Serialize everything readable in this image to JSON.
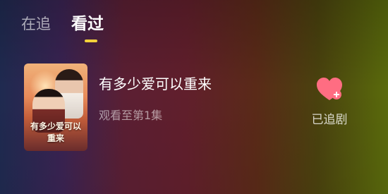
{
  "tabs": [
    {
      "label": "在追"
    },
    {
      "label": "看过"
    }
  ],
  "active_tab_index": 1,
  "list": [
    {
      "title": "有多少爱可以重来",
      "progress": "观看至第1集",
      "follow_label": "已追剧",
      "poster_title": "有多少爱可以重来",
      "poster_icon": "poster-thumbnail"
    }
  ],
  "colors": {
    "accent_indicator": "#f3d23a",
    "heart": "#ff6d82"
  }
}
